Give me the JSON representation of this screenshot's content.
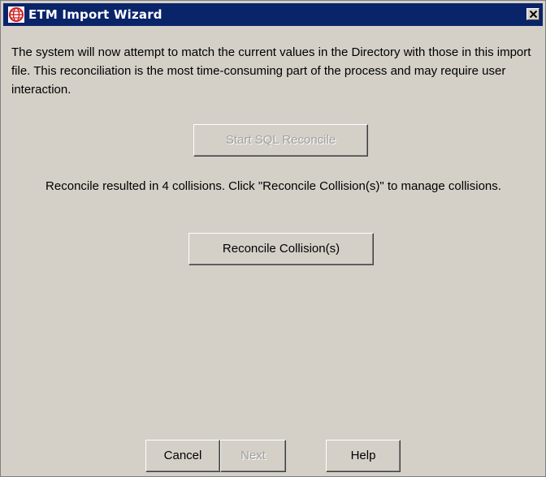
{
  "window": {
    "title": "ETM Import Wizard",
    "icon": "etm-globe-icon",
    "close_icon": "close-x-icon",
    "accent_color": "#0a246a"
  },
  "main": {
    "intro_text": "The system will now attempt to match the current values in the Directory with those in this import file.  This reconciliation is the most time-consuming part of the process and may require user interaction.",
    "start_button_label": "Start SQL Reconcile",
    "start_button_enabled": false,
    "status_text": "Reconcile resulted in 4 collisions.  Click \"Reconcile Collision(s)\" to manage collisions.",
    "reconcile_button_label": "Reconcile Collision(s)",
    "reconcile_button_enabled": true
  },
  "footer": {
    "cancel_label": "Cancel",
    "cancel_enabled": true,
    "next_label": "Next",
    "next_enabled": false,
    "help_label": "Help",
    "help_enabled": true
  }
}
